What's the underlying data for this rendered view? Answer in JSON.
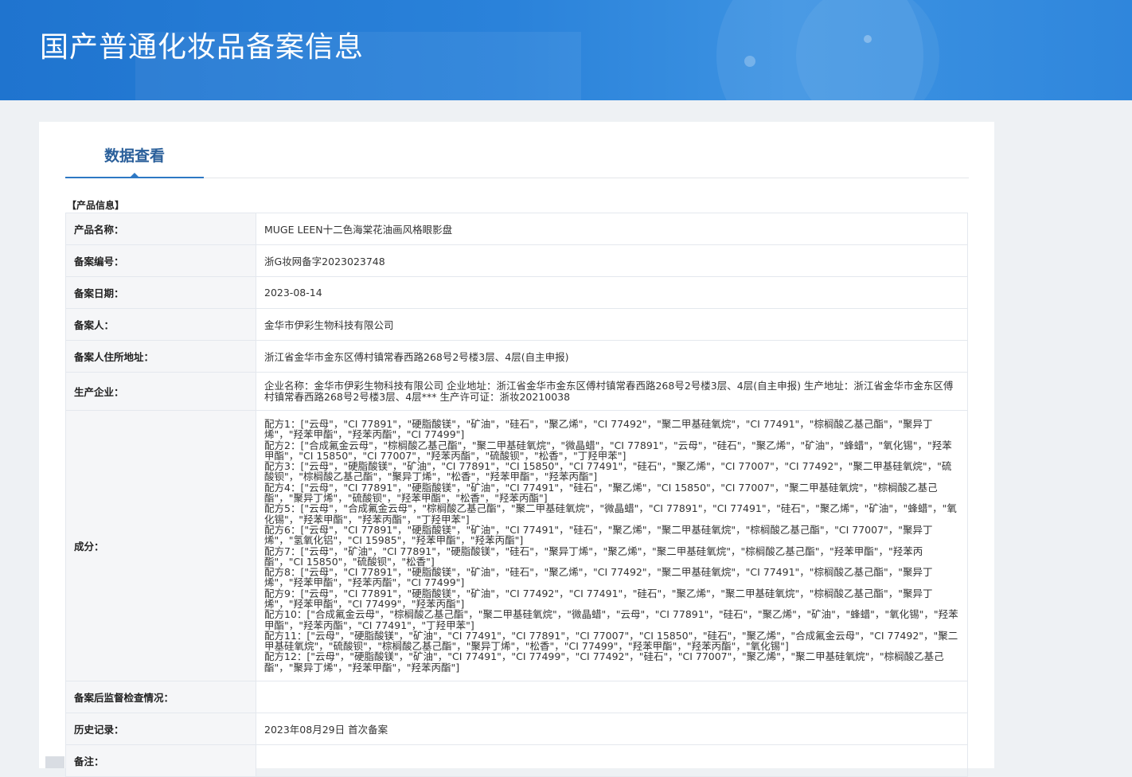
{
  "page": {
    "title": "国产普通化妆品备案信息"
  },
  "tabs": [
    {
      "label": "数据查看"
    }
  ],
  "section": {
    "title": "【产品信息】"
  },
  "fields": {
    "product_name": {
      "label": "产品名称：",
      "value": "MUGE LEEN十二色海棠花油画风格眼影盘"
    },
    "record_no": {
      "label": "备案编号：",
      "value": "浙G妆网备字2023023748"
    },
    "record_date": {
      "label": "备案日期：",
      "value": "2023-08-14"
    },
    "registrant": {
      "label": "备案人：",
      "value": "金华市伊彩生物科技有限公司"
    },
    "registrant_address": {
      "label": "备案人住所地址：",
      "value": "浙江省金华市金东区傅村镇常春西路268号2号楼3层、4层(自主申报)"
    },
    "manufacturer": {
      "label": "生产企业：",
      "value": "企业名称：金华市伊彩生物科技有限公司 企业地址：浙江省金华市金东区傅村镇常春西路268号2号楼3层、4层(自主申报) 生产地址：浙江省金华市金东区傅村镇常春西路268号2号楼3层、4层*** 生产许可证：浙妆20210038"
    },
    "ingredients": {
      "label": "成分：",
      "formulas": [
        "配方1：[\"云母\"，\"CI 77891\"，\"硬脂酸镁\"，\"矿油\"，\"硅石\"，\"聚乙烯\"，\"CI 77492\"，\"聚二甲基硅氧烷\"，\"CI 77491\"，\"棕榈酸乙基己酯\"，\"聚异丁烯\"，\"羟苯甲酯\"，\"羟苯丙酯\"，\"CI 77499\"]",
        "配方2：[\"合成氟金云母\"，\"棕榈酸乙基己酯\"，\"聚二甲基硅氧烷\"，\"微晶蜡\"，\"CI 77891\"，\"云母\"，\"硅石\"，\"聚乙烯\"，\"矿油\"，\"蜂蜡\"，\"氧化锡\"，\"羟苯甲酯\"，\"CI 15850\"，\"CI 77007\"，\"羟苯丙酯\"，\"硫酸钡\"，\"松香\"，\"丁羟甲苯\"]",
        "配方3：[\"云母\"，\"硬脂酸镁\"，\"矿油\"，\"CI 77891\"，\"CI 15850\"，\"CI 77491\"，\"硅石\"，\"聚乙烯\"，\"CI 77007\"，\"CI 77492\"，\"聚二甲基硅氧烷\"，\"硫酸钡\"，\"棕榈酸乙基己酯\"，\"聚异丁烯\"，\"松香\"，\"羟苯甲酯\"，\"羟苯丙酯\"]",
        "配方4：[\"云母\"，\"CI 77891\"，\"硬脂酸镁\"，\"矿油\"，\"CI 77491\"，\"硅石\"，\"聚乙烯\"，\"CI 15850\"，\"CI 77007\"，\"聚二甲基硅氧烷\"，\"棕榈酸乙基己酯\"，\"聚异丁烯\"，\"硫酸钡\"，\"羟苯甲酯\"，\"松香\"，\"羟苯丙酯\"]",
        "配方5：[\"云母\"，\"合成氟金云母\"，\"棕榈酸乙基己酯\"，\"聚二甲基硅氧烷\"，\"微晶蜡\"，\"CI 77891\"，\"CI 77491\"，\"硅石\"，\"聚乙烯\"，\"矿油\"，\"蜂蜡\"，\"氧化锡\"，\"羟苯甲酯\"，\"羟苯丙酯\"，\"丁羟甲苯\"]",
        "配方6：[\"云母\"，\"CI 77891\"，\"硬脂酸镁\"，\"矿油\"，\"CI 77491\"，\"硅石\"，\"聚乙烯\"，\"聚二甲基硅氧烷\"，\"棕榈酸乙基己酯\"，\"CI 77007\"，\"聚异丁烯\"，\"氢氧化铝\"，\"CI 15985\"，\"羟苯甲酯\"，\"羟苯丙酯\"]",
        "配方7：[\"云母\"，\"矿油\"，\"CI 77891\"，\"硬脂酸镁\"，\"硅石\"，\"聚异丁烯\"，\"聚乙烯\"，\"聚二甲基硅氧烷\"，\"棕榈酸乙基己酯\"，\"羟苯甲酯\"，\"羟苯丙酯\"，\"CI 15850\"，\"硫酸钡\"，\"松香\"]",
        "配方8：[\"云母\"，\"CI 77891\"，\"硬脂酸镁\"，\"矿油\"，\"硅石\"，\"聚乙烯\"，\"CI 77492\"，\"聚二甲基硅氧烷\"，\"CI 77491\"，\"棕榈酸乙基己酯\"，\"聚异丁烯\"，\"羟苯甲酯\"，\"羟苯丙酯\"，\"CI 77499\"]",
        "配方9：[\"云母\"，\"CI 77891\"，\"硬脂酸镁\"，\"矿油\"，\"CI 77492\"，\"CI 77491\"，\"硅石\"，\"聚乙烯\"，\"聚二甲基硅氧烷\"，\"棕榈酸乙基己酯\"，\"聚异丁烯\"，\"羟苯甲酯\"，\"CI 77499\"，\"羟苯丙酯\"]",
        "配方10：[\"合成氟金云母\"，\"棕榈酸乙基己酯\"，\"聚二甲基硅氧烷\"，\"微晶蜡\"，\"云母\"，\"CI 77891\"，\"硅石\"，\"聚乙烯\"，\"矿油\"，\"蜂蜡\"，\"氧化锡\"，\"羟苯甲酯\"，\"羟苯丙酯\"，\"CI 77491\"，\"丁羟甲苯\"]",
        "配方11：[\"云母\"，\"硬脂酸镁\"，\"矿油\"，\"CI 77491\"，\"CI 77891\"，\"CI 77007\"，\"CI 15850\"，\"硅石\"，\"聚乙烯\"，\"合成氟金云母\"，\"CI 77492\"，\"聚二甲基硅氧烷\"，\"硫酸钡\"，\"棕榈酸乙基己酯\"，\"聚异丁烯\"，\"松香\"，\"CI 77499\"，\"羟苯甲酯\"，\"羟苯丙酯\"，\"氧化锡\"]",
        "配方12：[\"云母\"，\"硬脂酸镁\"，\"矿油\"，\"CI 77491\"，\"CI 77499\"，\"CI 77492\"，\"硅石\"，\"CI 77007\"，\"聚乙烯\"，\"聚二甲基硅氧烷\"，\"棕榈酸乙基己酯\"，\"聚异丁烯\"，\"羟苯甲酯\"，\"羟苯丙酯\"]"
      ]
    },
    "post_inspection": {
      "label": "备案后监督检查情况：",
      "value": ""
    },
    "history": {
      "label": "历史记录：",
      "value": "2023年08月29日 首次备案"
    },
    "remarks": {
      "label": "备注：",
      "value": ""
    }
  }
}
